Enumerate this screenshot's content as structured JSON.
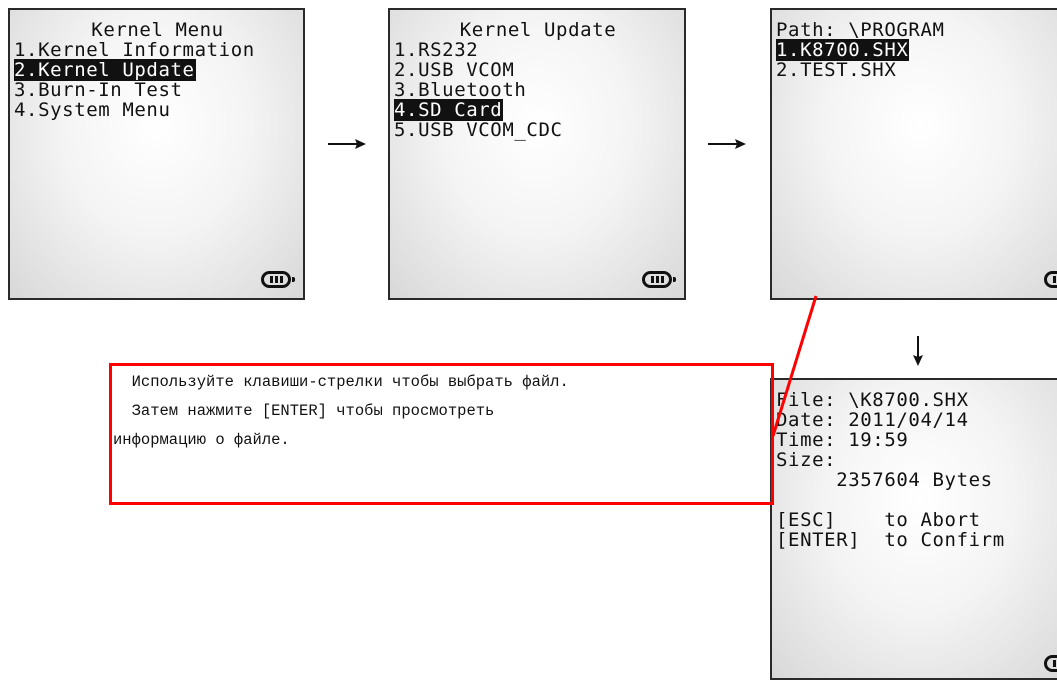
{
  "screens": [
    {
      "lines": [
        {
          "text": "Kernel Menu",
          "center": true
        },
        {
          "text": "1.Kernel Information"
        },
        {
          "text": "2.Kernel Update",
          "highlight": true
        },
        {
          "text": "3.Burn-In Test"
        },
        {
          "text": "4.System Menu"
        }
      ]
    },
    {
      "lines": [
        {
          "text": "Kernel Update",
          "center": true
        },
        {
          "text": "1.RS232"
        },
        {
          "text": "2.USB VCOM"
        },
        {
          "text": "3.Bluetooth"
        },
        {
          "text": "4.SD Card",
          "highlight": true
        },
        {
          "text": "5.USB VCOM_CDC"
        }
      ]
    },
    {
      "lines": [
        {
          "text": "Path: \\PROGRAM"
        },
        {
          "text": "1.K8700.SHX",
          "highlight": true
        },
        {
          "text": "2.TEST.SHX"
        }
      ]
    },
    {
      "lines": [
        {
          "text": "File: \\K8700.SHX"
        },
        {
          "text": "Date: 2011/04/14"
        },
        {
          "text": "Time: 19:59"
        },
        {
          "text": "Size:"
        },
        {
          "text": "     2357604 Bytes"
        },
        {
          "text": ""
        },
        {
          "text": "[ESC]    to Abort"
        },
        {
          "text": "[ENTER]  to Confirm"
        }
      ]
    }
  ],
  "callout": {
    "line1": "  Используйте клавиши-стрелки чтобы выбрать файл.",
    "line2": "  Затем нажмите [ENTER] чтобы просмотреть",
    "line3": "информацию о файле."
  },
  "colors": {
    "callout_border": "#ff0000",
    "highlight_bg": "#111111",
    "highlight_fg": "#ffffff"
  },
  "icons": {
    "battery": "battery-icon",
    "arrow_right": "arrow-right-icon",
    "arrow_down": "arrow-down-icon"
  }
}
